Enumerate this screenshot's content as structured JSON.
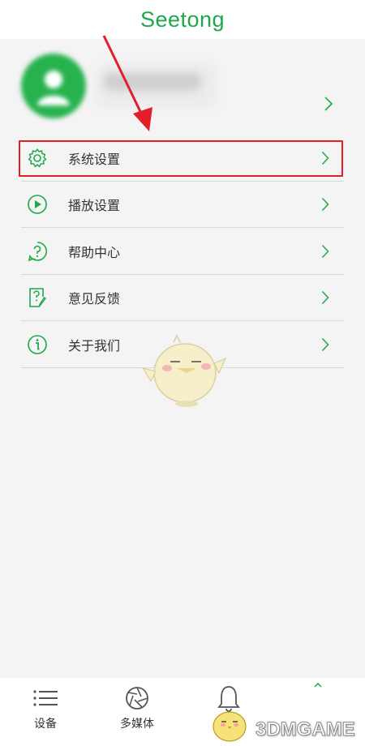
{
  "app": {
    "title": "Seetong",
    "accent_color": "#1fa84b"
  },
  "profile": {
    "avatar_icon": "user-avatar-icon",
    "username": "",
    "chevron_icon": "chevron-right-icon"
  },
  "menu": {
    "items": [
      {
        "label": "系统设置",
        "icon": "gear-icon"
      },
      {
        "label": "播放设置",
        "icon": "play-circle-icon"
      },
      {
        "label": "帮助中心",
        "icon": "help-circle-icon"
      },
      {
        "label": "意见反馈",
        "icon": "feedback-icon"
      },
      {
        "label": "关于我们",
        "icon": "info-circle-icon"
      }
    ],
    "highlight_color": "#e21e2b"
  },
  "tabbar": {
    "tabs": [
      {
        "label": "设备",
        "icon": "list-icon"
      },
      {
        "label": "多媒体",
        "icon": "aperture-icon"
      },
      {
        "label": "",
        "icon": "bell-icon"
      }
    ]
  },
  "watermark": {
    "text": "3DMGAME"
  }
}
